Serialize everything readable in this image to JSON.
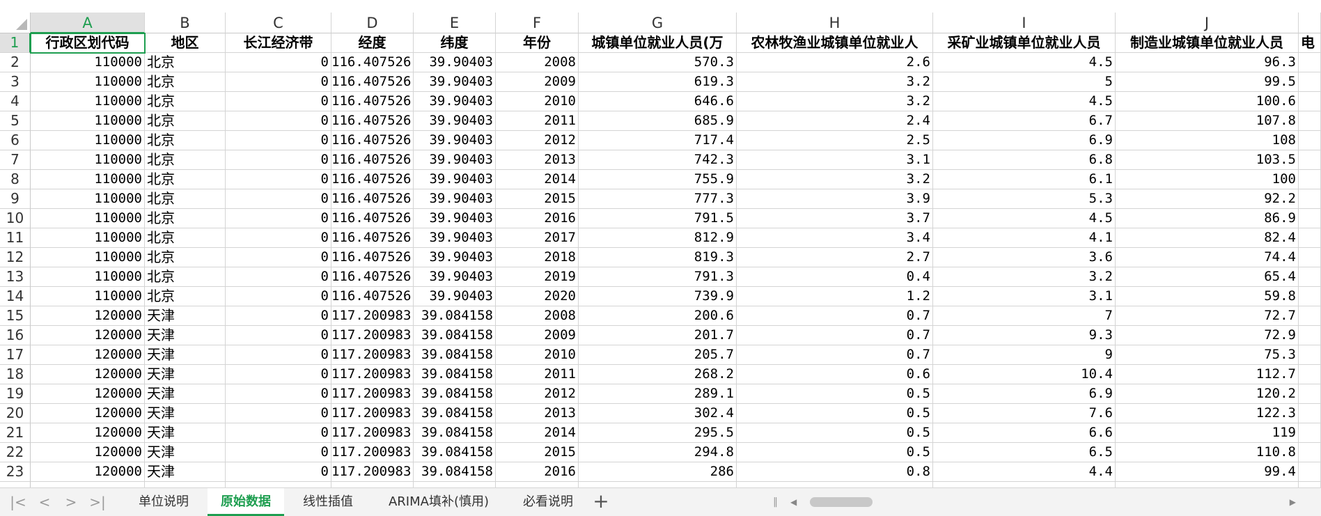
{
  "sheet": {
    "columns": [
      "A",
      "B",
      "C",
      "D",
      "E",
      "F",
      "G",
      "H",
      "I",
      "J"
    ],
    "selected_column": "A",
    "selected_row": 1,
    "header_row": [
      "行政区划代码",
      "地区",
      "长江经济带",
      "经度",
      "纬度",
      "年份",
      "城镇单位就业人员(万",
      "农林牧渔业城镇单位就业人",
      "采矿业城镇单位就业人员",
      "制造业城镇单位就业人员",
      "电"
    ],
    "rows": [
      [
        "110000",
        "北京",
        "0",
        "116.407526",
        "39.90403",
        "2008",
        "570.3",
        "2.6",
        "4.5",
        "96.3"
      ],
      [
        "110000",
        "北京",
        "0",
        "116.407526",
        "39.90403",
        "2009",
        "619.3",
        "3.2",
        "5",
        "99.5"
      ],
      [
        "110000",
        "北京",
        "0",
        "116.407526",
        "39.90403",
        "2010",
        "646.6",
        "3.2",
        "4.5",
        "100.6"
      ],
      [
        "110000",
        "北京",
        "0",
        "116.407526",
        "39.90403",
        "2011",
        "685.9",
        "2.4",
        "6.7",
        "107.8"
      ],
      [
        "110000",
        "北京",
        "0",
        "116.407526",
        "39.90403",
        "2012",
        "717.4",
        "2.5",
        "6.9",
        "108"
      ],
      [
        "110000",
        "北京",
        "0",
        "116.407526",
        "39.90403",
        "2013",
        "742.3",
        "3.1",
        "6.8",
        "103.5"
      ],
      [
        "110000",
        "北京",
        "0",
        "116.407526",
        "39.90403",
        "2014",
        "755.9",
        "3.2",
        "6.1",
        "100"
      ],
      [
        "110000",
        "北京",
        "0",
        "116.407526",
        "39.90403",
        "2015",
        "777.3",
        "3.9",
        "5.3",
        "92.2"
      ],
      [
        "110000",
        "北京",
        "0",
        "116.407526",
        "39.90403",
        "2016",
        "791.5",
        "3.7",
        "4.5",
        "86.9"
      ],
      [
        "110000",
        "北京",
        "0",
        "116.407526",
        "39.90403",
        "2017",
        "812.9",
        "3.4",
        "4.1",
        "82.4"
      ],
      [
        "110000",
        "北京",
        "0",
        "116.407526",
        "39.90403",
        "2018",
        "819.3",
        "2.7",
        "3.6",
        "74.4"
      ],
      [
        "110000",
        "北京",
        "0",
        "116.407526",
        "39.90403",
        "2019",
        "791.3",
        "0.4",
        "3.2",
        "65.4"
      ],
      [
        "110000",
        "北京",
        "0",
        "116.407526",
        "39.90403",
        "2020",
        "739.9",
        "1.2",
        "3.1",
        "59.8"
      ],
      [
        "120000",
        "天津",
        "0",
        "117.200983",
        "39.084158",
        "2008",
        "200.6",
        "0.7",
        "7",
        "72.7"
      ],
      [
        "120000",
        "天津",
        "0",
        "117.200983",
        "39.084158",
        "2009",
        "201.7",
        "0.7",
        "9.3",
        "72.9"
      ],
      [
        "120000",
        "天津",
        "0",
        "117.200983",
        "39.084158",
        "2010",
        "205.7",
        "0.7",
        "9",
        "75.3"
      ],
      [
        "120000",
        "天津",
        "0",
        "117.200983",
        "39.084158",
        "2011",
        "268.2",
        "0.6",
        "10.4",
        "112.7"
      ],
      [
        "120000",
        "天津",
        "0",
        "117.200983",
        "39.084158",
        "2012",
        "289.1",
        "0.5",
        "6.9",
        "120.2"
      ],
      [
        "120000",
        "天津",
        "0",
        "117.200983",
        "39.084158",
        "2013",
        "302.4",
        "0.5",
        "7.6",
        "122.3"
      ],
      [
        "120000",
        "天津",
        "0",
        "117.200983",
        "39.084158",
        "2014",
        "295.5",
        "0.5",
        "6.6",
        "119"
      ],
      [
        "120000",
        "天津",
        "0",
        "117.200983",
        "39.084158",
        "2015",
        "294.8",
        "0.5",
        "6.5",
        "110.8"
      ],
      [
        "120000",
        "天津",
        "0",
        "117.200983",
        "39.084158",
        "2016",
        "286",
        "0.8",
        "4.4",
        "99.4"
      ]
    ],
    "row_numbers": [
      "1",
      "2",
      "3",
      "4",
      "5",
      "6",
      "7",
      "8",
      "9",
      "10",
      "11",
      "12",
      "13",
      "14",
      "15",
      "16",
      "17",
      "18",
      "19",
      "20",
      "21",
      "22",
      "23"
    ]
  },
  "tabs": {
    "items": [
      {
        "label": "单位说明",
        "active": false
      },
      {
        "label": "原始数据",
        "active": true
      },
      {
        "label": "线性插值",
        "active": false
      },
      {
        "label": "ARIMA填补(慎用)",
        "active": false
      },
      {
        "label": "必看说明",
        "active": false
      }
    ],
    "add_label": "+",
    "nav": [
      "|<",
      "<",
      ">",
      ">|"
    ]
  },
  "colors": {
    "accent": "#1e9e50",
    "header_bg": "#e1e1e1",
    "grid": "#d4d4d4"
  }
}
